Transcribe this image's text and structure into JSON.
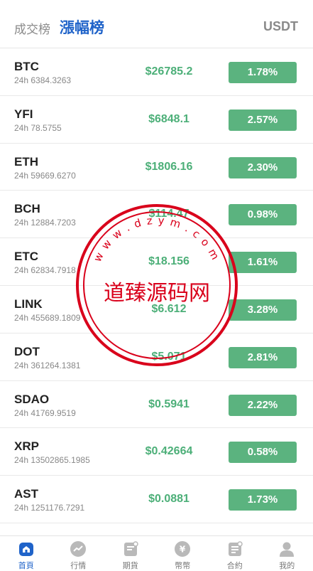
{
  "header": {
    "tab_volume": "成交榜",
    "tab_gain": "漲幅榜",
    "currency": "USDT"
  },
  "rows": [
    {
      "symbol": "BTC",
      "volume": "24h 6384.3263",
      "price": "$26785.2",
      "change": "1.78%"
    },
    {
      "symbol": "YFI",
      "volume": "24h 78.5755",
      "price": "$6848.1",
      "change": "2.57%"
    },
    {
      "symbol": "ETH",
      "volume": "24h 59669.6270",
      "price": "$1806.16",
      "change": "2.30%"
    },
    {
      "symbol": "BCH",
      "volume": "24h 12884.7203",
      "price": "$114.47",
      "change": "0.98%"
    },
    {
      "symbol": "ETC",
      "volume": "24h 62834.7918",
      "price": "$18.156",
      "change": "1.61%"
    },
    {
      "symbol": "LINK",
      "volume": "24h 455689.1809",
      "price": "$6.612",
      "change": "3.28%"
    },
    {
      "symbol": "DOT",
      "volume": "24h 361264.1381",
      "price": "$5.071",
      "change": "2.81%"
    },
    {
      "symbol": "SDAO",
      "volume": "24h 41769.9519",
      "price": "$0.5941",
      "change": "2.22%"
    },
    {
      "symbol": "XRP",
      "volume": "24h 13502865.1985",
      "price": "$0.42664",
      "change": "0.58%"
    },
    {
      "symbol": "AST",
      "volume": "24h 1251176.7291",
      "price": "$0.0881",
      "change": "1.73%"
    }
  ],
  "watermark": {
    "center_text": "道臻源码网",
    "ring_text": "www.dzym.com"
  },
  "tabbar": [
    {
      "label": "首頁",
      "icon": "home-icon",
      "active": true
    },
    {
      "label": "行情",
      "icon": "trend-icon",
      "active": false
    },
    {
      "label": "期貨",
      "icon": "futures-icon",
      "active": false
    },
    {
      "label": "幣幣",
      "icon": "coin-icon",
      "active": false
    },
    {
      "label": "合約",
      "icon": "contract-icon",
      "active": false
    },
    {
      "label": "我的",
      "icon": "user-icon",
      "active": false
    }
  ],
  "colors": {
    "accent": "#1f63c9",
    "up_green": "#4caf78",
    "badge_green": "#5bb37f",
    "watermark_red": "#d9001b"
  }
}
